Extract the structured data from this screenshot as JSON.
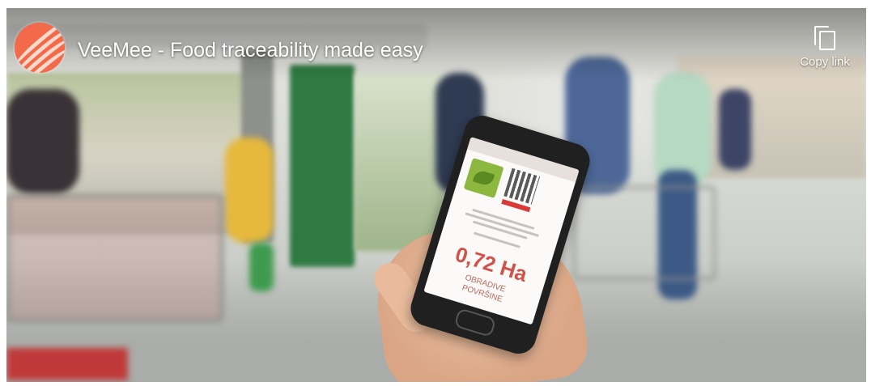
{
  "video": {
    "title": "VeeMee - Food traceability made easy",
    "copy_link_label": "Copy link",
    "channel_logo_icon": "veemee-logo-icon",
    "copy_icon": "copy-icon"
  },
  "phone_screen": {
    "value": "0,72 Ha",
    "caption_line1": "OBRADIVE",
    "caption_line2": "POVRŠINE"
  },
  "colors": {
    "logo": "#f26a4a",
    "value_text": "#d0524a"
  }
}
